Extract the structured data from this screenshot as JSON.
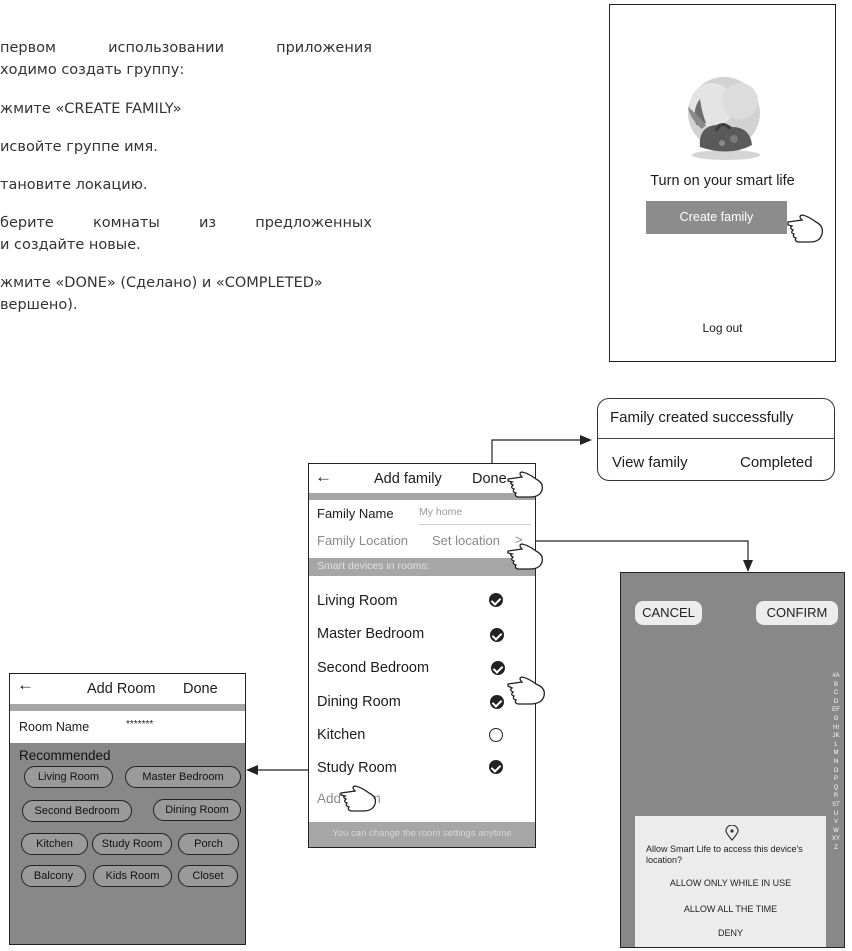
{
  "instructions": {
    "intro_line1": [
      "первом",
      "использовании",
      "приложения"
    ],
    "intro_line2": "ходимо создать группу:",
    "step1": "жмите «CREATE FAMILY»",
    "step2": "исвойте группе имя.",
    "step3": "тановите локацию.",
    "step4_line1": [
      "берите",
      "комнаты",
      "из",
      "предложенных"
    ],
    "step4_line2": "и создайте новые.",
    "step5_line1": "жмите «DONE» (Сделано) и «COMPLETED»",
    "step5_line2": "вершено)."
  },
  "welcome_screen": {
    "tagline": "Turn on your smart life",
    "create_button": "Create  family",
    "logout": "Log out"
  },
  "success_popup": {
    "title": "Family created successfully",
    "view_family": "View family",
    "completed": "Completed"
  },
  "add_family_screen": {
    "back_glyph": "←",
    "title": "Add family",
    "done": "Done",
    "family_name_label": "Family Name",
    "family_name_placeholder": "My home",
    "family_location_label": "Family Location",
    "set_location": "Set location",
    "chevron": ">",
    "rooms_header": "Smart devices in rooms:",
    "rooms": [
      {
        "name": "Living Room",
        "checked": true
      },
      {
        "name": "Master Bedroom",
        "checked": true
      },
      {
        "name": "Second Bedroom",
        "checked": true
      },
      {
        "name": "Dining Room",
        "checked": true
      },
      {
        "name": "Kitchen",
        "checked": false
      },
      {
        "name": "Study Room",
        "checked": true
      }
    ],
    "add_room": "Add Room",
    "footer_note": "You can change the room settings anytime"
  },
  "add_room_screen": {
    "back_glyph": "←",
    "title": "Add Room",
    "done": "Done",
    "room_name_label": "Room Name",
    "room_name_value": "*******",
    "recommended_label": "Recommended",
    "suggestions": [
      "Living Room",
      "Master Bedroom",
      "Second Bedroom",
      "Dining Room",
      "Kitchen",
      "Study Room",
      "Porch",
      "Balcony",
      "Kids Room",
      "Closet"
    ]
  },
  "location_screen": {
    "cancel": "CANCEL",
    "confirm": "CONFIRM",
    "alphabet": "#ABCDEFGHIJKLMNOPQRSTUVWXYZ",
    "permission_prompt": "Allow Smart Life to access this device's location?",
    "allow_in_use": "ALLOW  ONLY WHILE IN USE",
    "allow_always": "ALLOW  ALL THE TIME",
    "deny": "DENY",
    "location_pin_icon": "location-pin-icon"
  },
  "colors": {
    "panel_grey": "#888888",
    "header_grey": "#a6a6a6",
    "dialog_bg": "#ececec"
  }
}
